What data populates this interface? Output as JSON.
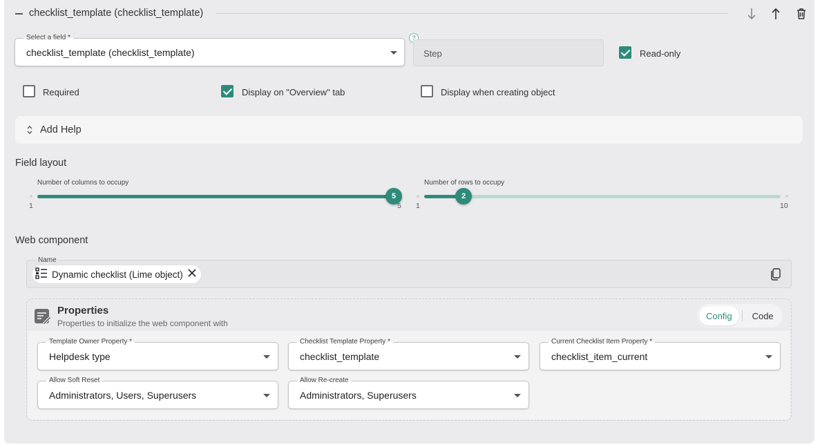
{
  "header": {
    "title": "checklist_template (checklist_template)",
    "icons": [
      "arrow-down-icon",
      "arrow-up-icon",
      "trash-icon"
    ]
  },
  "select_field": {
    "label": "Select a field",
    "required_mark": "*",
    "value": "checklist_template (checklist_template)"
  },
  "help_badge": "?",
  "step_field": {
    "placeholder": "Step"
  },
  "checkboxes": {
    "read_only": {
      "label": "Read-only",
      "checked": true
    },
    "required": {
      "label": "Required",
      "checked": false
    },
    "display_overview": {
      "label": "Display on \"Overview\" tab",
      "checked": true
    },
    "display_creating": {
      "label": "Display when creating object",
      "checked": false
    }
  },
  "add_help": {
    "label": "Add Help"
  },
  "field_layout": {
    "title": "Field layout",
    "columns": {
      "label": "Number of columns to occupy",
      "value": "5",
      "min": "1",
      "max": "5"
    },
    "rows": {
      "label": "Number of rows to occupy",
      "value": "2",
      "min": "1",
      "max": "10"
    }
  },
  "web_component": {
    "title": "Web component",
    "name_label": "Name",
    "chip_label": "Dynamic checklist (Lime object)"
  },
  "properties": {
    "title": "Properties",
    "subtitle": "Properties to initialize the web component with",
    "tabs": [
      {
        "label": "Config",
        "active": true
      },
      {
        "label": "Code",
        "active": false
      }
    ],
    "fields": [
      {
        "label": "Template Owner Property",
        "required": "*",
        "value": "Helpdesk type"
      },
      {
        "label": "Checklist Template Property",
        "required": "*",
        "value": "checklist_template"
      },
      {
        "label": "Current Checklist Item Property",
        "required": "*",
        "value": "checklist_item_current"
      },
      {
        "label": "Allow Soft Reset",
        "required": "",
        "value": "Administrators, Users, Superusers"
      },
      {
        "label": "Allow Re-create",
        "required": "",
        "value": "Administrators, Superusers"
      }
    ]
  },
  "colors": {
    "accent": "#2e8b7a",
    "panel": "#ebebed",
    "track_light": "#b9dad4"
  }
}
